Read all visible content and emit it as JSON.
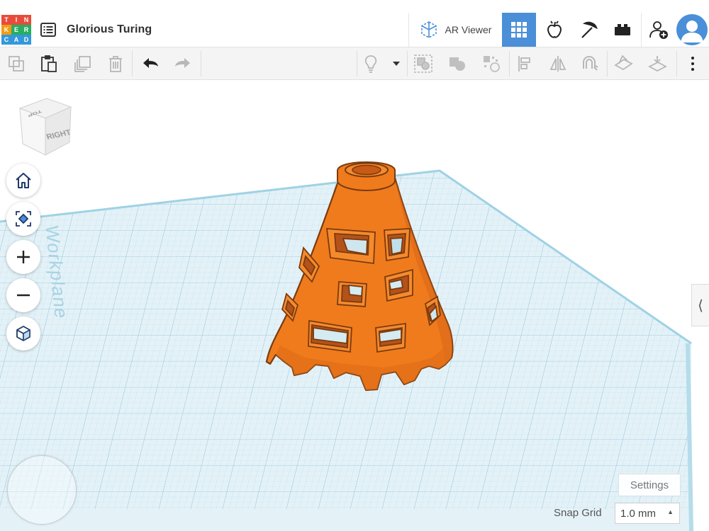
{
  "header": {
    "logo_letters": [
      "T",
      "I",
      "N",
      "K",
      "E",
      "R",
      "C",
      "A",
      "D"
    ],
    "logo_colors": [
      "#e84b3c",
      "#e84b3c",
      "#e84b3c",
      "#f39c12",
      "#27ae60",
      "#27ae60",
      "#3498db",
      "#3498db",
      "#3498db"
    ],
    "title": "Glorious Turing",
    "ar_viewer_label": "AR Viewer",
    "active_view": "grid-view",
    "accent_color": "#4a8fd8"
  },
  "toolbar": {
    "tools": [
      "copy",
      "paste",
      "duplicate",
      "delete",
      "undo",
      "redo",
      "light-bulb",
      "dropdown",
      "group",
      "ungroup",
      "cruise",
      "align",
      "mirror",
      "magnet",
      "workplane",
      "import"
    ]
  },
  "viewport": {
    "viewcube_face_label": "RIGHT",
    "viewcube_top_label": "TOP",
    "workplane_label": "Workplane",
    "shape_color": "#f07b1d",
    "plane_color": "#d8ecf4"
  },
  "nav_buttons": [
    "home-icon",
    "fit-view-icon",
    "zoom-in-icon",
    "zoom-out-icon",
    "perspective-icon"
  ],
  "footer": {
    "settings_label": "Settings",
    "snap_grid_label": "Snap Grid",
    "snap_grid_value": "1.0 mm"
  }
}
